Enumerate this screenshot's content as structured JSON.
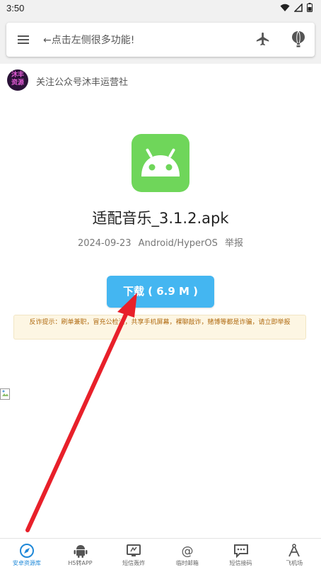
{
  "status_bar": {
    "time": "3:50"
  },
  "search": {
    "text": "←点击左侧很多功能!"
  },
  "notice": {
    "logo_text": "沐丰资源",
    "text": "关注公众号沐丰运营社"
  },
  "app": {
    "name": "适配音乐_3.1.2.apk",
    "date": "2024-09-23",
    "platform": "Android/HyperOS",
    "report": "举报"
  },
  "download": {
    "label": "下载 ( 6.9 M )"
  },
  "warning": {
    "text": "反诈提示：刷单兼职，冒充公检法，共享手机屏幕，裸聊敲诈，赌博等都是诈骗，请立即举报"
  },
  "nav": {
    "items": [
      {
        "label": "安卓资源库",
        "icon": "compass-icon",
        "active": true
      },
      {
        "label": "H5转APP",
        "icon": "android-icon",
        "active": false
      },
      {
        "label": "短信轰炸",
        "icon": "monitor-icon",
        "active": false
      },
      {
        "label": "临时邮箱",
        "icon": "at-icon",
        "active": false
      },
      {
        "label": "短信接码",
        "icon": "message-icon",
        "active": false
      },
      {
        "label": "飞机场",
        "icon": "compass-draw-icon",
        "active": false
      }
    ]
  },
  "colors": {
    "accent": "#44b6f1",
    "app_icon": "#6fd65a",
    "nav_active": "#1e88d8",
    "arrow": "#e8202a"
  }
}
